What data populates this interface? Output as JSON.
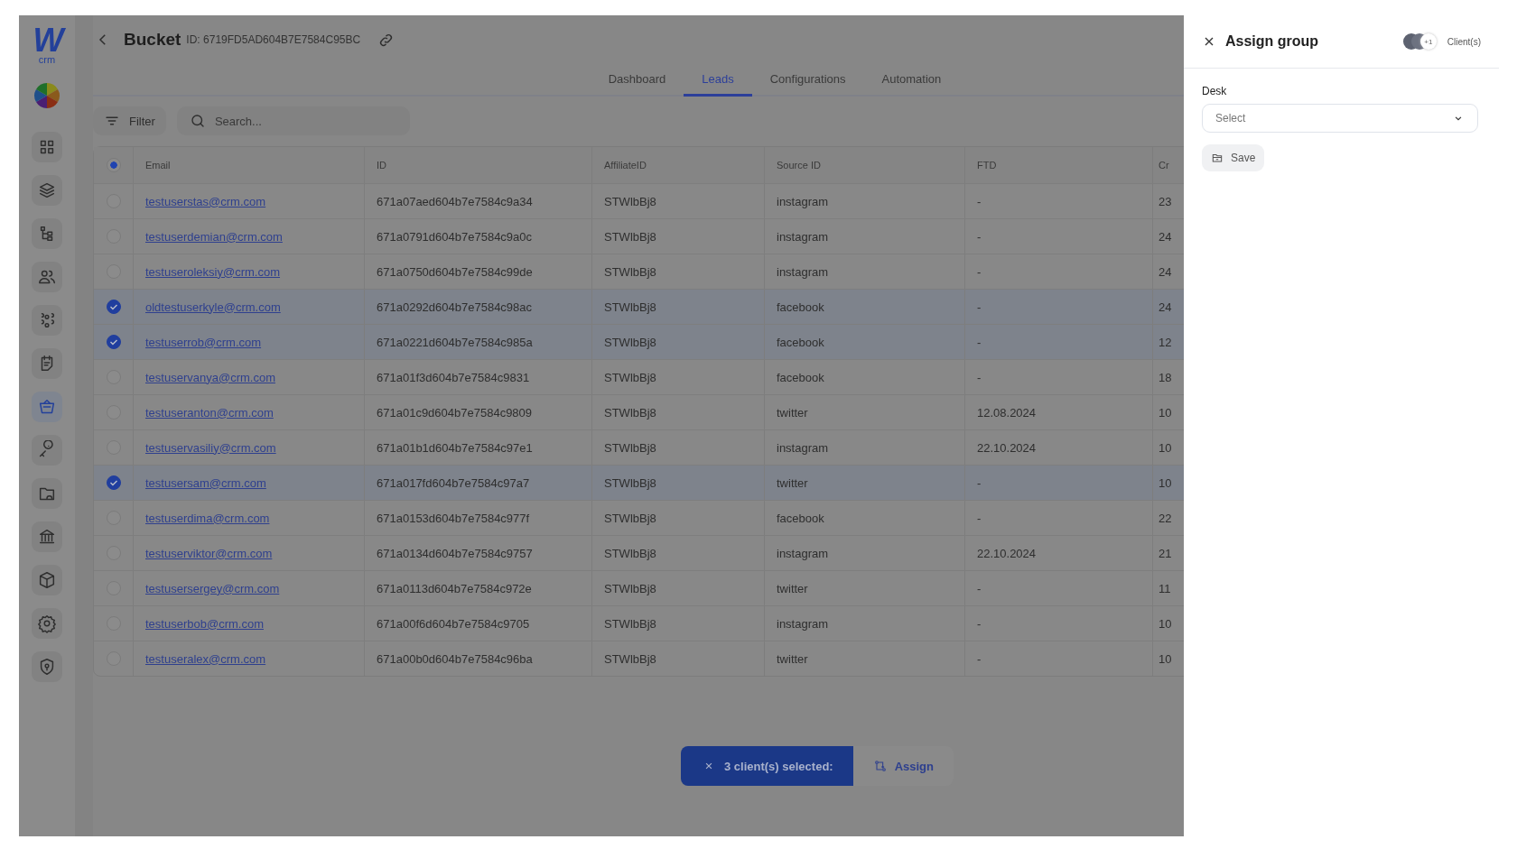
{
  "sidebar": {
    "logo": {
      "mark": "W",
      "text": "crm"
    },
    "items": [
      {
        "selected": false
      },
      {
        "selected": false
      },
      {
        "selected": false
      },
      {
        "selected": false
      },
      {
        "selected": false
      },
      {
        "selected": false
      },
      {
        "selected": true
      },
      {
        "selected": false
      },
      {
        "selected": false
      },
      {
        "selected": false
      },
      {
        "selected": false
      },
      {
        "selected": false
      },
      {
        "selected": false
      }
    ]
  },
  "header": {
    "title": "Bucket",
    "id_text": "ID: 6719FD5AD604B7E7584C95BC"
  },
  "tabs": [
    {
      "label": "Dashboard",
      "selected": false
    },
    {
      "label": "Leads",
      "selected": true
    },
    {
      "label": "Configurations",
      "selected": false
    },
    {
      "label": "Automation",
      "selected": false
    }
  ],
  "toolbar": {
    "filter": "Filter",
    "search": {
      "placeholder": "Search..."
    }
  },
  "table": {
    "select_all": {
      "indeterminate": true
    },
    "columns": [
      "Email",
      "ID",
      "AffiliateID",
      "Source ID",
      "FTD",
      "Cr"
    ],
    "rows": [
      {
        "selected": false,
        "cells": [
          "testuserstas@crm.com",
          "671a07aed604b7e7584c9a34",
          "STWlbBj8",
          "instagram",
          "-",
          "23"
        ]
      },
      {
        "selected": false,
        "cells": [
          "testuserdemian@crm.com",
          "671a0791d604b7e7584c9a0c",
          "STWlbBj8",
          "instagram",
          "-",
          "24"
        ]
      },
      {
        "selected": false,
        "cells": [
          "testuseroleksiy@crm.com",
          "671a0750d604b7e7584c99de",
          "STWlbBj8",
          "instagram",
          "-",
          "24"
        ]
      },
      {
        "selected": true,
        "cells": [
          "oldtestuserkyle@crm.com",
          "671a0292d604b7e7584c98ac",
          "STWlbBj8",
          "facebook",
          "-",
          "24"
        ]
      },
      {
        "selected": true,
        "cells": [
          "testuserrob@crm.com",
          "671a0221d604b7e7584c985a",
          "STWlbBj8",
          "facebook",
          "-",
          "12"
        ]
      },
      {
        "selected": false,
        "cells": [
          "testuservanya@crm.com",
          "671a01f3d604b7e7584c9831",
          "STWlbBj8",
          "facebook",
          "-",
          "18"
        ]
      },
      {
        "selected": false,
        "cells": [
          "testuseranton@crm.com",
          "671a01c9d604b7e7584c9809",
          "STWlbBj8",
          "twitter",
          "12.08.2024",
          "10"
        ]
      },
      {
        "selected": false,
        "cells": [
          "testuservasiliy@crm.com",
          "671a01b1d604b7e7584c97e1",
          "STWlbBj8",
          "instagram",
          "22.10.2024",
          "10"
        ]
      },
      {
        "selected": true,
        "cells": [
          "testusersam@crm.com",
          "671a017fd604b7e7584c97a7",
          "STWlbBj8",
          "twitter",
          "-",
          "10"
        ]
      },
      {
        "selected": false,
        "cells": [
          "testuserdima@crm.com",
          "671a0153d604b7e7584c977f",
          "STWlbBj8",
          "facebook",
          "-",
          "22"
        ]
      },
      {
        "selected": false,
        "cells": [
          "testuserviktor@crm.com",
          "671a0134d604b7e7584c9757",
          "STWlbBj8",
          "instagram",
          "22.10.2024",
          "21"
        ]
      },
      {
        "selected": false,
        "cells": [
          "testusersergey@crm.com",
          "671a0113d604b7e7584c972e",
          "STWlbBj8",
          "twitter",
          "-",
          "11"
        ]
      },
      {
        "selected": false,
        "cells": [
          "testuserbob@crm.com",
          "671a00f6d604b7e7584c9705",
          "STWlbBj8",
          "instagram",
          "-",
          "10"
        ]
      },
      {
        "selected": false,
        "cells": [
          "testuseralex@crm.com",
          "671a00b0d604b7e7584c96ba",
          "STWlbBj8",
          "twitter",
          "-",
          "10"
        ]
      }
    ]
  },
  "selection_bar": {
    "text": "3 client(s) selected:",
    "action": "Assign"
  },
  "drawer": {
    "title": "Assign group",
    "more_count": "+1",
    "clients_label": "Client(s)",
    "field_label": "Desk",
    "select": {
      "placeholder": "Select"
    },
    "save": "Save"
  }
}
